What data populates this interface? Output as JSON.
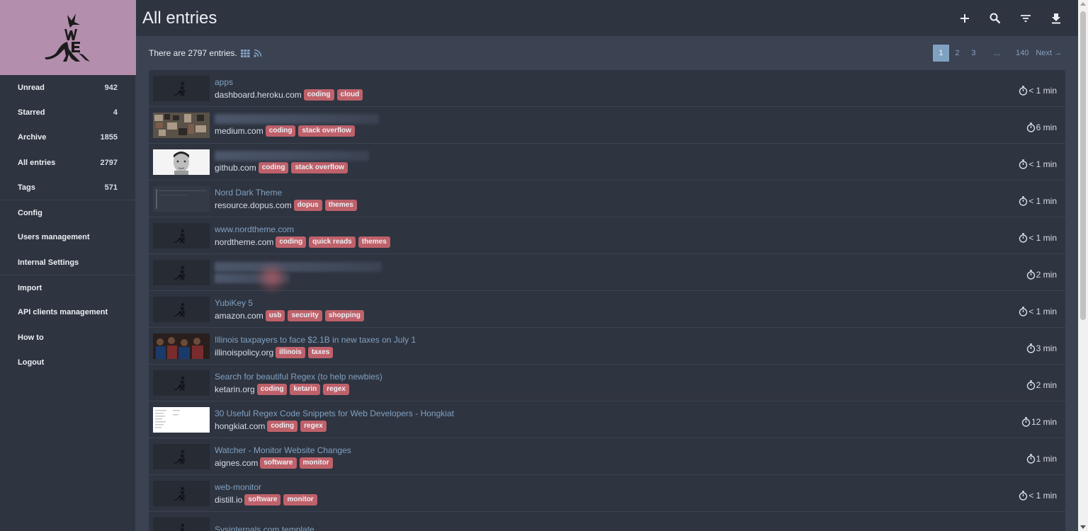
{
  "app": {
    "title": "All entries",
    "brand_color": "#b48ead"
  },
  "sidebar": {
    "items": [
      {
        "label": "Unread",
        "count": "942"
      },
      {
        "label": "Starred",
        "count": "4"
      },
      {
        "label": "Archive",
        "count": "1855"
      },
      {
        "label": "All entries",
        "count": "2797"
      },
      {
        "label": "Tags",
        "count": "571"
      },
      {
        "label": "Config"
      },
      {
        "label": "Users management"
      },
      {
        "label": "Internal Settings"
      },
      {
        "label": "Import"
      },
      {
        "label": "API clients management"
      },
      {
        "label": "How to"
      },
      {
        "label": "Logout"
      }
    ]
  },
  "toolbar": {
    "icons": [
      "plus-icon",
      "search-icon",
      "filter-icon",
      "download-icon"
    ]
  },
  "info": {
    "count_text": "There are 2797 entries."
  },
  "pagination": {
    "pages": [
      "1",
      "2",
      "3",
      "...",
      "140"
    ],
    "active": "1",
    "next_label": "Next →"
  },
  "entries": [
    {
      "title": "apps",
      "domain": "dashboard.heroku.com",
      "tags": [
        "coding",
        "cloud"
      ],
      "reading_time": "< 1 min",
      "thumb": "logo"
    },
    {
      "title": "",
      "domain": "medium.com",
      "tags": [
        "coding",
        "stack overflow"
      ],
      "reading_time": "6 min",
      "thumb": "photo-collage"
    },
    {
      "title": "",
      "domain": "github.com",
      "tags": [
        "coding",
        "stack overflow"
      ],
      "reading_time": "< 1 min",
      "thumb": "portrait"
    },
    {
      "title": "Nord Dark Theme",
      "domain": "resource.dopus.com",
      "tags": [
        "dopus",
        "themes"
      ],
      "reading_time": "< 1 min",
      "thumb": "screenshot-dark"
    },
    {
      "title": "www.nordtheme.com",
      "domain": "nordtheme.com",
      "tags": [
        "coding",
        "quick reads",
        "themes"
      ],
      "reading_time": "< 1 min",
      "thumb": "logo"
    },
    {
      "title": "",
      "domain": "",
      "tags": [],
      "reading_time": "2 min",
      "thumb": "logo"
    },
    {
      "title": "YubiKey 5",
      "domain": "amazon.com",
      "tags": [
        "usb",
        "security",
        "shopping"
      ],
      "reading_time": "< 1 min",
      "thumb": "logo"
    },
    {
      "title": "Illinois taxpayers to face $2.1B in new taxes on July 1",
      "domain": "illinoispolicy.org",
      "tags": [
        "illinois",
        "taxes"
      ],
      "reading_time": "3 min",
      "thumb": "photo-crowd"
    },
    {
      "title": "Search for beautiful Regex (to help newbies)",
      "domain": "ketarin.org",
      "tags": [
        "coding",
        "ketarin",
        "regex"
      ],
      "reading_time": "2 min",
      "thumb": "logo"
    },
    {
      "title": "30 Useful Regex Code Snippets for Web Developers - Hongkiat",
      "domain": "hongkiat.com",
      "tags": [
        "coding",
        "regex"
      ],
      "reading_time": "12 min",
      "thumb": "screenshot-light"
    },
    {
      "title": "Watcher - Monitor Website Changes",
      "domain": "aignes.com",
      "tags": [
        "software",
        "monitor"
      ],
      "reading_time": "1 min",
      "thumb": "logo"
    },
    {
      "title": "web-monitor",
      "domain": "distill.io",
      "tags": [
        "software",
        "monitor"
      ],
      "reading_time": "< 1 min",
      "thumb": "logo"
    },
    {
      "title": "Sysinternals.com template",
      "domain": "",
      "tags": [],
      "reading_time": "",
      "thumb": "logo"
    }
  ]
}
